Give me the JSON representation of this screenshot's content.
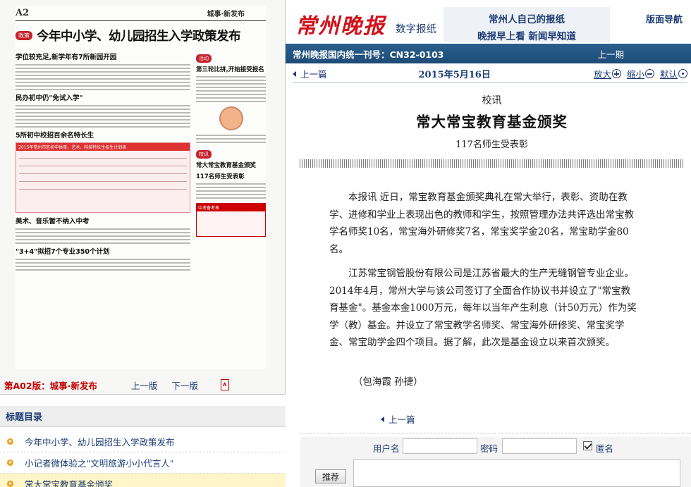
{
  "thumbnail": {
    "header_page": "A2",
    "header_section": "城事·新发布",
    "headline_tag": "政策",
    "headline": "今年中小学、幼儿园招生入学政策发布",
    "sub1": "学位较充足,新学年有7所新园开园",
    "sub2": "民办初中仍\"免试入学\"",
    "sub3": "5所初中校招百余名特长生",
    "table_title": "2015年常州市区初中体育、艺术、科技特长生招生计划表",
    "sub4": "美术、音乐暂不纳入中考",
    "sub5": "\"3+4\"拟招7个专业350个计划",
    "right_tag": "活动",
    "right_title1": "第三轮比拼,开始接受报名",
    "right_tag2": "校讯",
    "right_title2": "常大常宝教育基金颁奖",
    "right_sub2": "117名师生受表彰",
    "sched_title": "中考备考表"
  },
  "page_label": "第A02版：城事·新发布",
  "prev_page": "上一版",
  "next_page": "下一版",
  "toc": {
    "title": "标题目录",
    "items": [
      "今年中小学、幼儿园招生入学政策发布",
      "小记者微体验之\"文明旅游小小代言人\"",
      "常大常宝教育基金颁奖"
    ]
  },
  "header": {
    "logo": "常州晚报",
    "digital": "数字报纸",
    "slogan1": "常州人自己的报纸",
    "slogan2": "晚报早上看 新闻早知道",
    "nav": "版面导航"
  },
  "bluebar": {
    "issn": "常州晚报国内统一刊号：CN32-0103",
    "prev": "上一期"
  },
  "datebar": {
    "back": "上一篇",
    "date": "2015年5月16日",
    "zoom_in": "放大",
    "zoom_out": "缩小",
    "default": "默认"
  },
  "article": {
    "eyebrow": "校讯",
    "headline": "常大常宝教育基金颁奖",
    "subhead": "117名师生受表彰",
    "p1": "本报讯 近日，常宝教育基金颁奖典礼在常大举行，表彰、资助在教学、进修和学业上表现出色的教师和学生，按照管理办法共评选出常宝教学名师奖10名，常宝海外研修奖7名，常宝奖学金20名，常宝助学金80名。",
    "p2": "江苏常宝钢管股份有限公司是江苏省最大的生产无缝钢管专业企业。2014年4月，常州大学与该公司签订了全面合作协议书并设立了\"常宝教育基金\"。基金本金1000万元，每年以当年产生利息（计50万元）作为奖学（教）基金。并设立了常宝教学名师奖、常宝海外研修奖、常宝奖学金、常宝助学金四个项目。据了解，此次是基金设立以来首次颁奖。",
    "byline": "（包海霞 孙捷）"
  },
  "bottom": {
    "back": "上一篇",
    "username_label": "用户名",
    "password_label": "密码",
    "anonymous_label": "匿名",
    "recommend": "推荐"
  }
}
